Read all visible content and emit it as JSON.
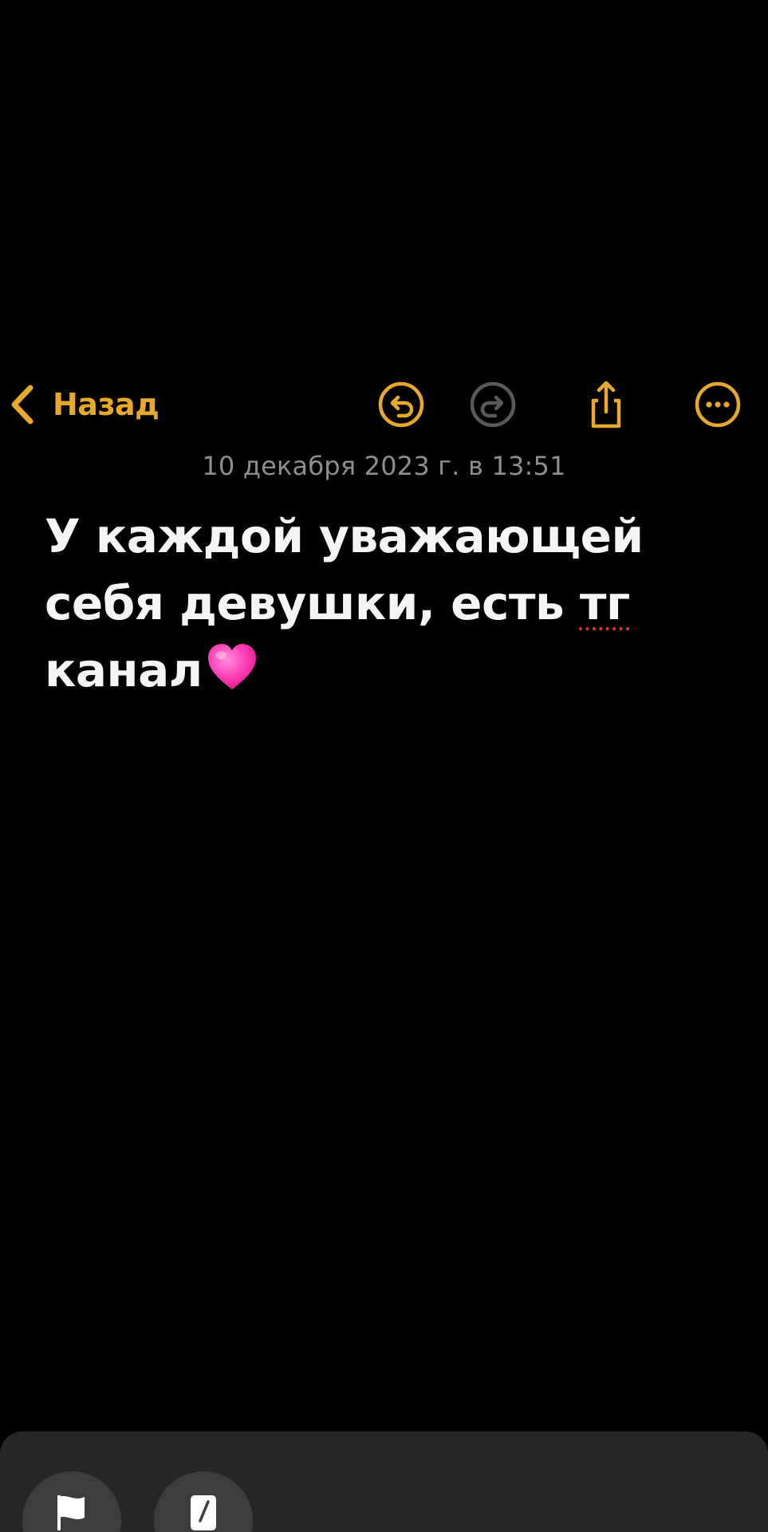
{
  "nav": {
    "back_label": "Назад",
    "accent_color": "#e7a92b",
    "icons": {
      "back": "chevron-left-icon",
      "undo": "undo-icon",
      "redo": "redo-icon",
      "share": "share-icon",
      "more": "ellipsis-circle-icon"
    }
  },
  "note": {
    "timestamp": "10 декабря 2023 г. в 13:51",
    "line1": "У каждой уважающей",
    "line2_prefix": "себя девушки, есть ",
    "line2_underlined": "тг",
    "line3": "канал",
    "emoji": "pink-heart-icon"
  },
  "bottom_sheet": {
    "icons": [
      "flag-icon",
      "pencil-icon"
    ]
  }
}
